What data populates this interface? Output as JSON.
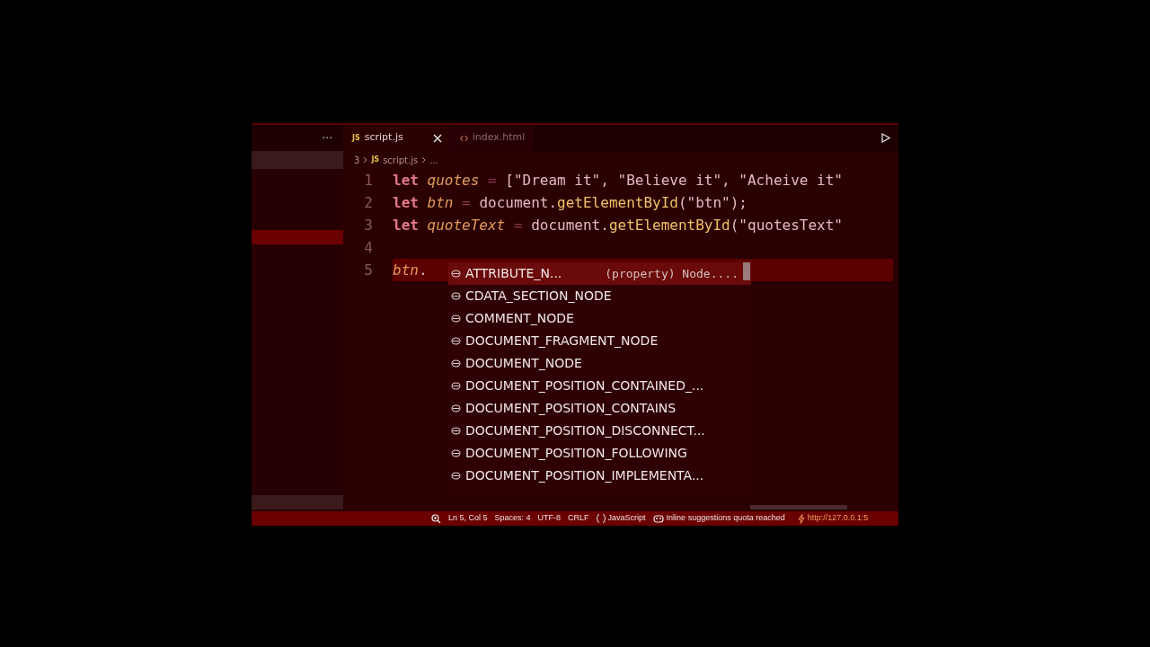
{
  "sidebar": {
    "more": "···"
  },
  "tabs": [
    {
      "label": "script.js",
      "badge": "JS",
      "kind": "js",
      "selected": true
    },
    {
      "label": "index.html",
      "kind": "html",
      "selected": false
    }
  ],
  "breadcrumb": [
    {
      "label": "3"
    },
    {
      "label": "script.js",
      "badge": "JS"
    },
    {
      "label": "..."
    }
  ],
  "code_lines": [
    {
      "number": "1",
      "selected": false,
      "tokens": [
        {
          "kind": "keyword",
          "text": "let"
        },
        {
          "kind": "variable",
          "text": "quotes"
        },
        {
          "kind": "operator",
          "text": "="
        },
        {
          "kind": "plain",
          "text": "[\"Dream it\", \"Believe it\", \"Acheive it\""
        }
      ]
    },
    {
      "number": "2",
      "selected": false,
      "tokens": [
        {
          "kind": "keyword",
          "text": "let"
        },
        {
          "kind": "variable",
          "text": "btn"
        },
        {
          "kind": "operator",
          "text": "="
        },
        {
          "kind": "plain",
          "text": "document."
        },
        {
          "kind": "function",
          "text": "getElementById"
        },
        {
          "kind": "plain",
          "text": "(\"btn\");"
        }
      ]
    },
    {
      "number": "3",
      "selected": false,
      "tokens": [
        {
          "kind": "keyword",
          "text": "let"
        },
        {
          "kind": "variable",
          "text": "quoteText"
        },
        {
          "kind": "operator",
          "text": "="
        },
        {
          "kind": "plain",
          "text": "document."
        },
        {
          "kind": "function",
          "text": "getElementById"
        },
        {
          "kind": "plain",
          "text": "(\"quotesText\""
        }
      ]
    },
    {
      "number": "4",
      "selected": false
    },
    {
      "number": "5",
      "selected": true,
      "tokens": [
        {
          "kind": "variable",
          "text": "btn"
        },
        {
          "kind": "plain",
          "text": "."
        }
      ]
    }
  ],
  "suggestions": [
    {
      "label": "ATTRIBUTE_N...",
      "detail": "(property) Node....",
      "selected": true
    },
    {
      "label": "CDATA_SECTION_NODE",
      "selected": false
    },
    {
      "label": "COMMENT_NODE",
      "selected": false
    },
    {
      "label": "DOCUMENT_FRAGMENT_NODE",
      "selected": false
    },
    {
      "label": "DOCUMENT_NODE",
      "selected": false
    },
    {
      "label": "DOCUMENT_POSITION_CONTAINED_...",
      "selected": false
    },
    {
      "label": "DOCUMENT_POSITION_CONTAINS",
      "selected": false
    },
    {
      "label": "DOCUMENT_POSITION_DISCONNECT...",
      "selected": false
    },
    {
      "label": "DOCUMENT_POSITION_FOLLOWING",
      "selected": false
    },
    {
      "label": "DOCUMENT_POSITION_IMPLEMENTA...",
      "selected": false
    }
  ],
  "status_bar": [
    {
      "kind": "zoom"
    },
    {
      "kind": "text",
      "text": "Ln 5, Col 5"
    },
    {
      "kind": "text",
      "text": "Spaces: 4"
    },
    {
      "kind": "text",
      "text": "UTF-8"
    },
    {
      "kind": "text",
      "text": "CRLF"
    },
    {
      "kind": "language",
      "text": "JavaScript"
    },
    {
      "kind": "copilot",
      "text": "Inline suggestions quota reached"
    },
    {
      "kind": "server",
      "text": "http://127.0.0.1:5"
    }
  ]
}
